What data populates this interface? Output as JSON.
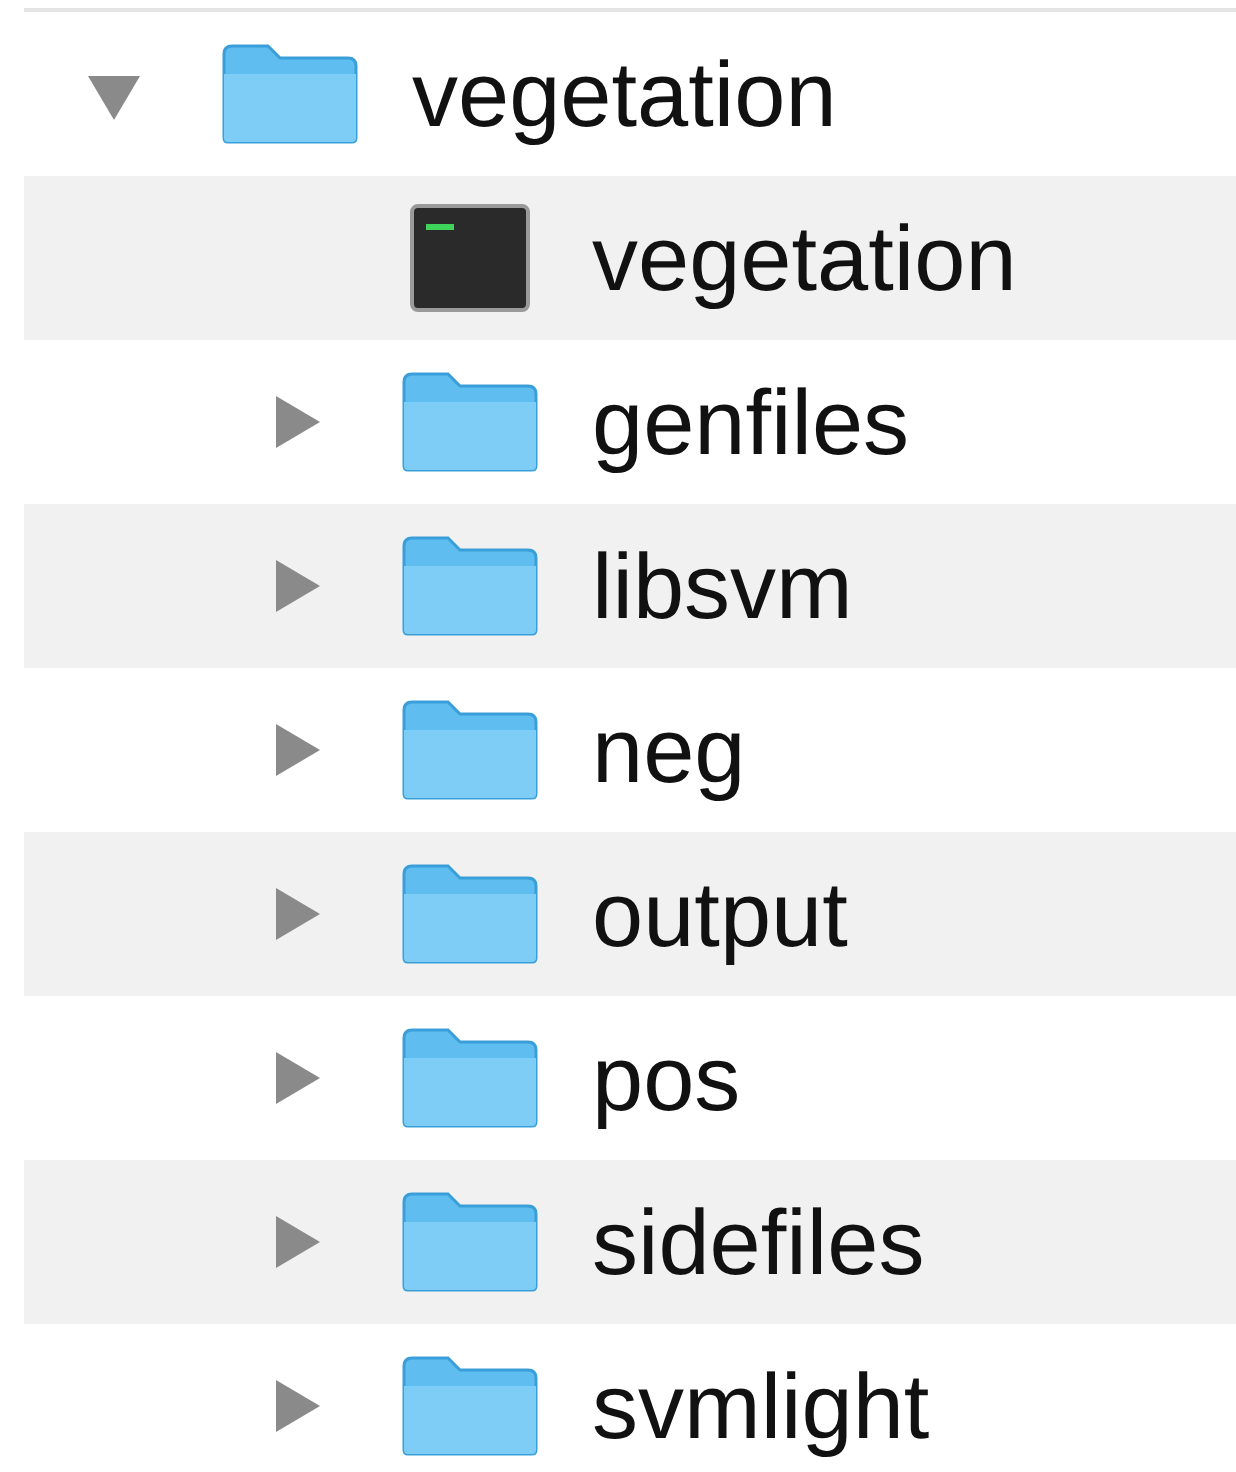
{
  "tree": [
    {
      "name": "vegetation",
      "kind": "folder",
      "expanded": true,
      "children": [
        {
          "name": "vegetation",
          "kind": "executable"
        },
        {
          "name": "genfiles",
          "kind": "folder",
          "expanded": false
        },
        {
          "name": "libsvm",
          "kind": "folder",
          "expanded": false
        },
        {
          "name": "neg",
          "kind": "folder",
          "expanded": false
        },
        {
          "name": "output",
          "kind": "folder",
          "expanded": false
        },
        {
          "name": "pos",
          "kind": "folder",
          "expanded": false
        },
        {
          "name": "sidefiles",
          "kind": "folder",
          "expanded": false
        },
        {
          "name": "svmlight",
          "kind": "folder",
          "expanded": false
        }
      ]
    }
  ]
}
